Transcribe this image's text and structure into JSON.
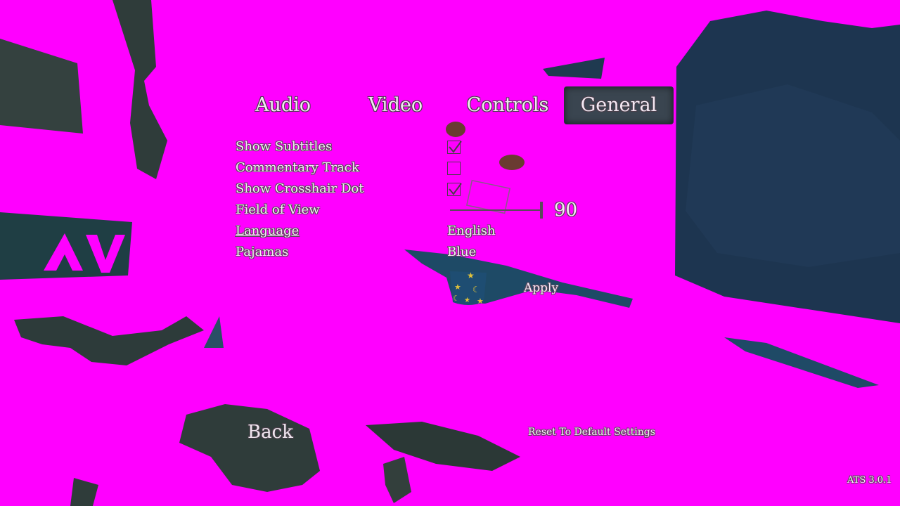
{
  "tabs": {
    "audio": "Audio",
    "video": "Video",
    "controls": "Controls",
    "general": "General",
    "active": "General"
  },
  "settings": {
    "show_subtitles": {
      "label": "Show Subtitles",
      "checked": true
    },
    "commentary_track": {
      "label": "Commentary Track",
      "checked": false
    },
    "show_crosshair_dot": {
      "label": "Show Crosshair Dot",
      "checked": true
    },
    "field_of_view": {
      "label": "Field of View",
      "value": "90"
    },
    "language": {
      "label": "Language",
      "value": "English"
    },
    "pajamas": {
      "label": "Pajamas",
      "value": "Blue"
    }
  },
  "buttons": {
    "apply": "Apply",
    "back": "Back",
    "reset": "Reset To Default Settings"
  },
  "version": "ATS 3.0.1",
  "colors": {
    "background": "#ff00ff",
    "active_tab_bg": "#3a4550",
    "text": "#f6e8f6",
    "text_outline": "#5d4a5d",
    "scene_dark": "#2d3a40",
    "scene_blue": "#1c3550"
  },
  "icons": {
    "checkbox_checked": "check-icon",
    "pajama_preview": "star-moon-icon"
  }
}
